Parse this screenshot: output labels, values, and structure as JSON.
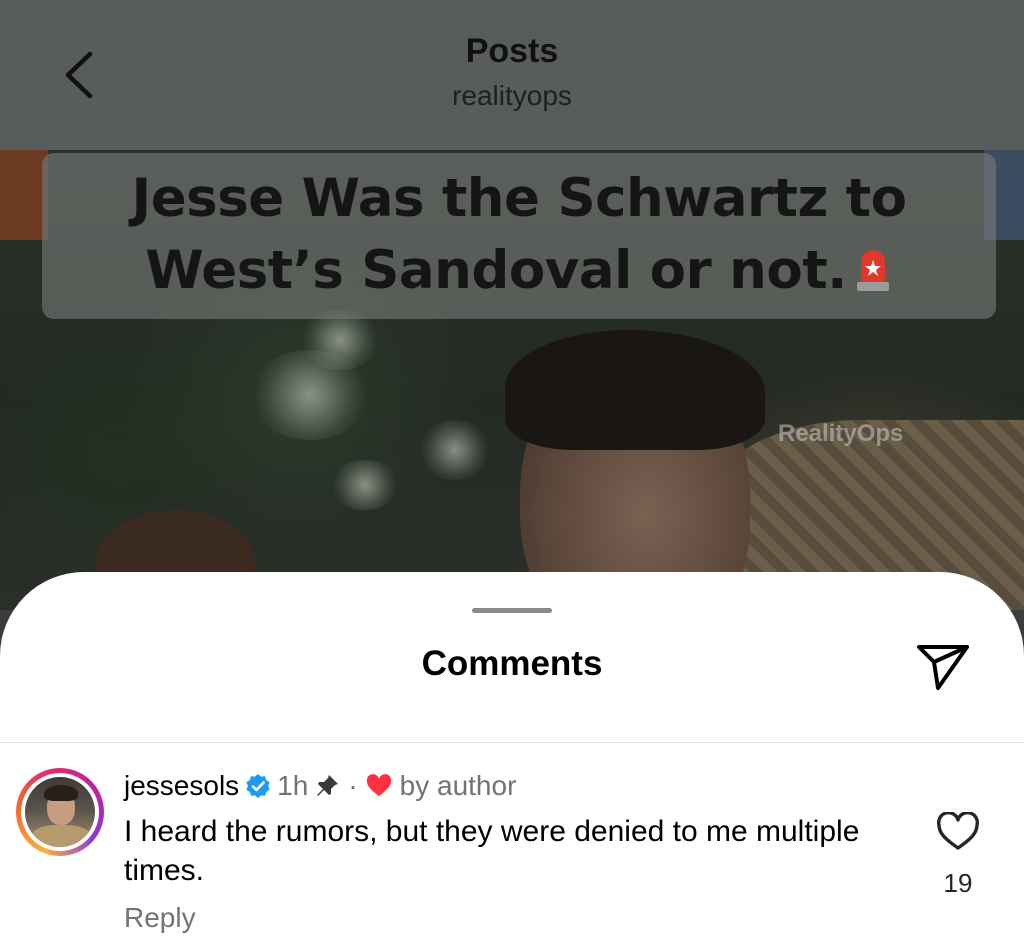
{
  "nav": {
    "title": "Posts",
    "subtitle": "realityops",
    "back_icon": "chevron-left-icon"
  },
  "post": {
    "headline": "Jesse Was the Schwartz to\nWest’s Sandoval or not.",
    "headline_icon": "siren-emoji-icon",
    "watermark": "RealityOps"
  },
  "comments_sheet": {
    "title": "Comments",
    "share_icon": "paper-plane-icon",
    "comments": [
      {
        "username": "jessesols",
        "verified": true,
        "time": "1h",
        "pinned": true,
        "separator": "·",
        "liked_by_author_label": "by author",
        "text": "I heard the rumors, but they were denied to me multiple times.",
        "reply_label": "Reply",
        "like_count": "19"
      }
    ]
  },
  "colors": {
    "verified_blue": "#1d9bf0",
    "heart_red": "#ff3040",
    "muted_text": "#737373"
  }
}
